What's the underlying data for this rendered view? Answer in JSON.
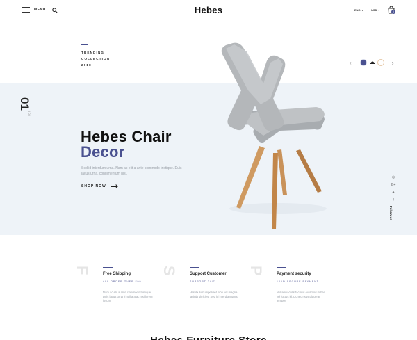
{
  "header": {
    "menu_label": "MENU",
    "logo": "Hebes",
    "language": "ENG",
    "currency": "USD",
    "cart_count": "0"
  },
  "hero": {
    "trending": [
      "TRENDING",
      "COLLECTION",
      "2018"
    ],
    "slide_number": "01",
    "slide_total": "/ 03",
    "title_line1": "Hebes Chair",
    "title_line2": "Decor",
    "description": "Sed id interdum urna. Nam ac elit a ante commodo tristique. Duis lacus urna, condimentum nisi.",
    "cta": "SHOP NOW",
    "accent_color": "#4a5190",
    "background_color": "#eef3f8"
  },
  "slider": {
    "prev_icon": "chevron-left-icon",
    "next_icon": "chevron-right-icon",
    "thumbnails": [
      "navy",
      "black-hat",
      "wood"
    ]
  },
  "social": {
    "icons": [
      "instagram-icon",
      "google-plus-icon",
      "twitter-icon",
      "facebook-icon"
    ],
    "glyphs": [
      "◎",
      "G+",
      "✦",
      "f"
    ],
    "follow_label": "Follow us"
  },
  "features": [
    {
      "letter": "F",
      "title": "Free Shipping",
      "subtitle": "ALL ORDER OVER $99",
      "description": "Nam ac elit a ante commodo tristique. Duis lacus urna fringilla a ac nisi lorem ipsum."
    },
    {
      "letter": "S",
      "title": "Support Customer",
      "subtitle": "SUPPORT 24/7",
      "description": "Vestibulum imperdiet nibh vel magna lacinia ultricies. Sed id interdum urna."
    },
    {
      "letter": "P",
      "title": "Payment security",
      "subtitle": "100% SECURE PAYMENT",
      "description": "Nullam iaculis facilisis euismod in hac vel luctus id. Donec risus placerat tempor."
    }
  ],
  "bottom_title": "Hebes Furniture Store"
}
